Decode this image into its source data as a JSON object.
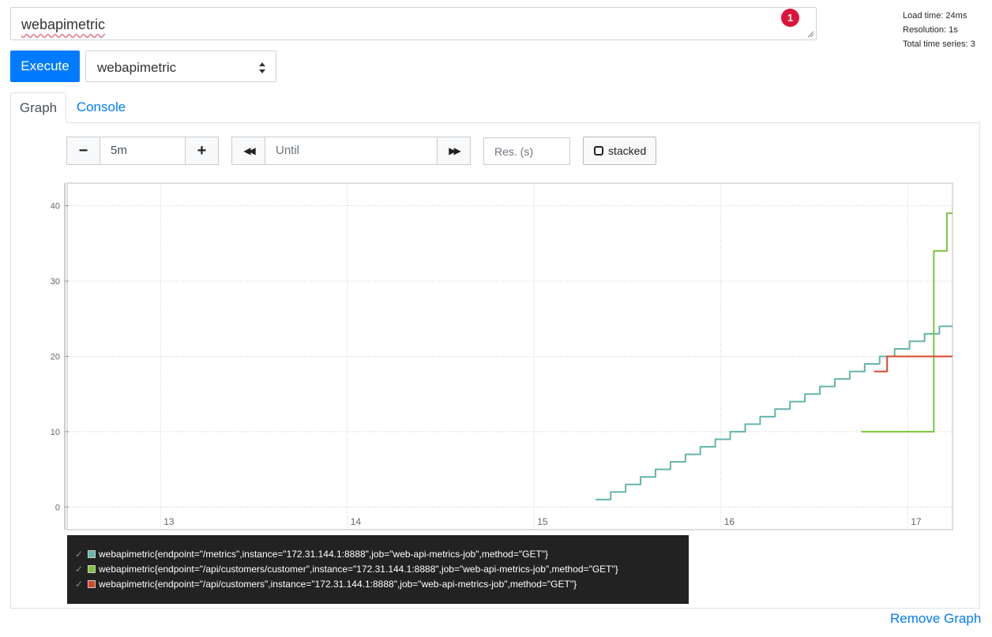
{
  "expression": {
    "value": "webapimetric",
    "error_count": "1"
  },
  "stats": {
    "load_time": "Load time: 24ms",
    "resolution": "Resolution: 1s",
    "total_series": "Total time series: 3"
  },
  "toolbar": {
    "execute_label": "Execute",
    "metric_selected": "webapimetric"
  },
  "tabs": {
    "graph": "Graph",
    "console": "Console"
  },
  "range": {
    "minus": "−",
    "plus": "+",
    "duration": "5m",
    "back": "◀◀",
    "forward": "▶▶",
    "until_placeholder": "Until",
    "resolution_placeholder": "Res. (s)",
    "stacked_label": "stacked"
  },
  "colors": {
    "accent": "#007bff",
    "series_1": "#64b5ad",
    "series_2": "#7cc43f",
    "series_3": "#d9472b"
  },
  "chart_data": {
    "type": "line",
    "title": "",
    "xlabel": "",
    "ylabel": "",
    "xlim": [
      12.5,
      17.24
    ],
    "ylim": [
      -3,
      43
    ],
    "x_ticks": [
      13,
      14,
      15,
      16,
      17
    ],
    "y_ticks": [
      0,
      10,
      20,
      30,
      40
    ],
    "grid": true,
    "series": [
      {
        "name": "webapimetric{endpoint=\"/metrics\",instance=\"172.31.144.1:8888\",job=\"web-api-metrics-job\",method=\"GET\"}",
        "color": "#64b5ad",
        "step": true,
        "x": [
          15.33,
          15.41,
          15.49,
          15.57,
          15.65,
          15.73,
          15.81,
          15.89,
          15.97,
          16.05,
          16.13,
          16.21,
          16.29,
          16.37,
          16.45,
          16.53,
          16.61,
          16.69,
          16.77,
          16.85,
          16.93,
          17.01,
          17.09,
          17.17,
          17.24
        ],
        "y": [
          1,
          2,
          3,
          4,
          5,
          6,
          7,
          8,
          9,
          10,
          11,
          12,
          13,
          14,
          15,
          16,
          17,
          18,
          19,
          20,
          21,
          22,
          23,
          24,
          24
        ]
      },
      {
        "name": "webapimetric{endpoint=\"/api/customers/customer\",instance=\"172.31.144.1:8888\",job=\"web-api-metrics-job\",method=\"GET\"}",
        "color": "#7cc43f",
        "step": true,
        "x": [
          16.75,
          17.14,
          17.21,
          17.24
        ],
        "y": [
          10,
          34,
          39,
          39
        ]
      },
      {
        "name": "webapimetric{endpoint=\"/api/customers\",instance=\"172.31.144.1:8888\",job=\"web-api-metrics-job\",method=\"GET\"}",
        "color": "#d9472b",
        "step": true,
        "x": [
          16.82,
          16.89,
          17.24
        ],
        "y": [
          18,
          20,
          20
        ]
      }
    ]
  },
  "legend": [
    {
      "check": "✓",
      "label": "webapimetric{endpoint=\"/metrics\",instance=\"172.31.144.1:8888\",job=\"web-api-metrics-job\",method=\"GET\"}"
    },
    {
      "check": "✓",
      "label": "webapimetric{endpoint=\"/api/customers/customer\",instance=\"172.31.144.1:8888\",job=\"web-api-metrics-job\",method=\"GET\"}"
    },
    {
      "check": "✓",
      "label": "webapimetric{endpoint=\"/api/customers\",instance=\"172.31.144.1:8888\",job=\"web-api-metrics-job\",method=\"GET\"}"
    }
  ],
  "footer": {
    "remove_graph": "Remove Graph"
  }
}
